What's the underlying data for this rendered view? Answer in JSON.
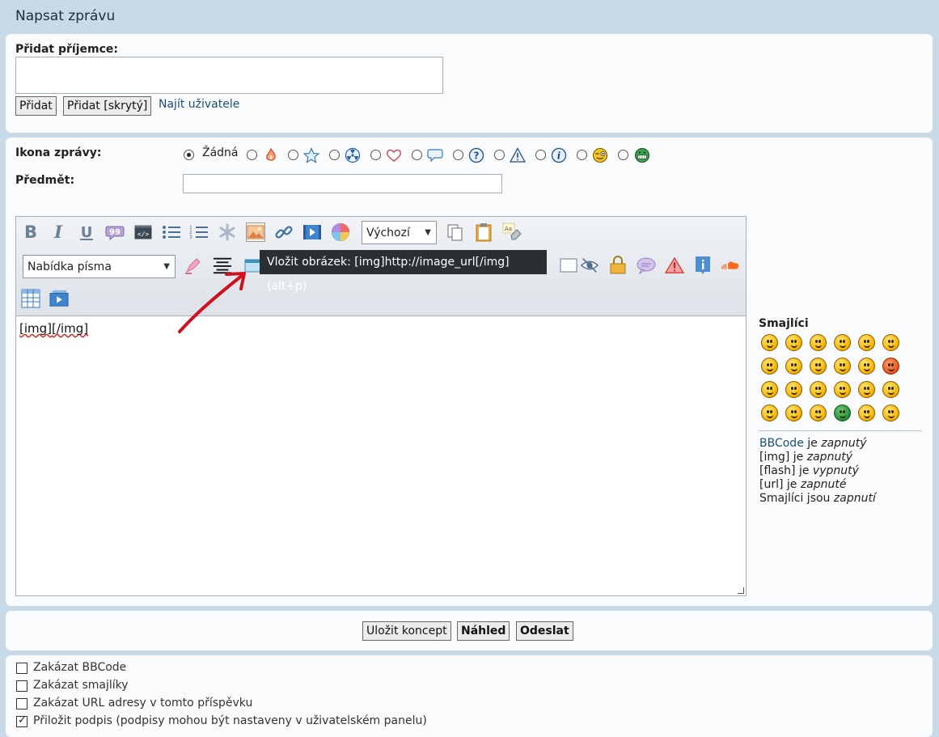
{
  "page": {
    "title": "Napsat zprávu"
  },
  "recipients": {
    "label": "Přidat příjemce:",
    "add_button": "Přidat",
    "add_hidden_button": "Přidat [skrytý]",
    "find_user_link": "Najít uživatele"
  },
  "message_icon": {
    "label": "Ikona zprávy:",
    "none_label": "Žádná",
    "selected": "none",
    "icons": [
      "fire-icon",
      "star-icon",
      "radioactive-icon",
      "heart-icon",
      "speech-bubble-icon",
      "question-icon",
      "warning-icon",
      "info-icon",
      "wink-smiley-icon",
      "green-grin-icon"
    ]
  },
  "subject": {
    "label": "Předmět:",
    "value": ""
  },
  "toolbar": {
    "color_select": "Výchozí",
    "font_select": "Nabídka písma",
    "tooltip": "Vložit obrázek: [img]http://image_url[/img]  (alt+p)"
  },
  "editor": {
    "content_a": "[img]",
    "content_b": "[/img]"
  },
  "smilies": {
    "title": "Smajlíci"
  },
  "status": {
    "bbcode_link": "BBCode",
    "bbcode_is": "je",
    "bbcode_state": "zapnutý",
    "img_tag": "[img] je",
    "img_state": "zapnutý",
    "flash_tag": "[flash] je",
    "flash_state": "vypnutý",
    "url_tag": "[url] je",
    "url_state": "zapnuté",
    "smilies_text": "Smajlíci jsou",
    "smilies_state": "zapnutí"
  },
  "actions": {
    "save_draft": "Uložit koncept",
    "preview": "Náhled",
    "submit": "Odeslat"
  },
  "options": [
    {
      "label": "Zakázat BBCode",
      "checked": false
    },
    {
      "label": "Zakázat smajlíky",
      "checked": false
    },
    {
      "label": "Zakázat URL adresy v tomto příspěvku",
      "checked": false
    },
    {
      "label": "Přiložit podpis (podpisy mohou být nastaveny v uživatelském panelu)",
      "checked": true
    }
  ],
  "colors": {
    "accent_link": "#1d4f7e",
    "background": "#c8d9e8",
    "annotation_arrow": "#d1101e"
  }
}
